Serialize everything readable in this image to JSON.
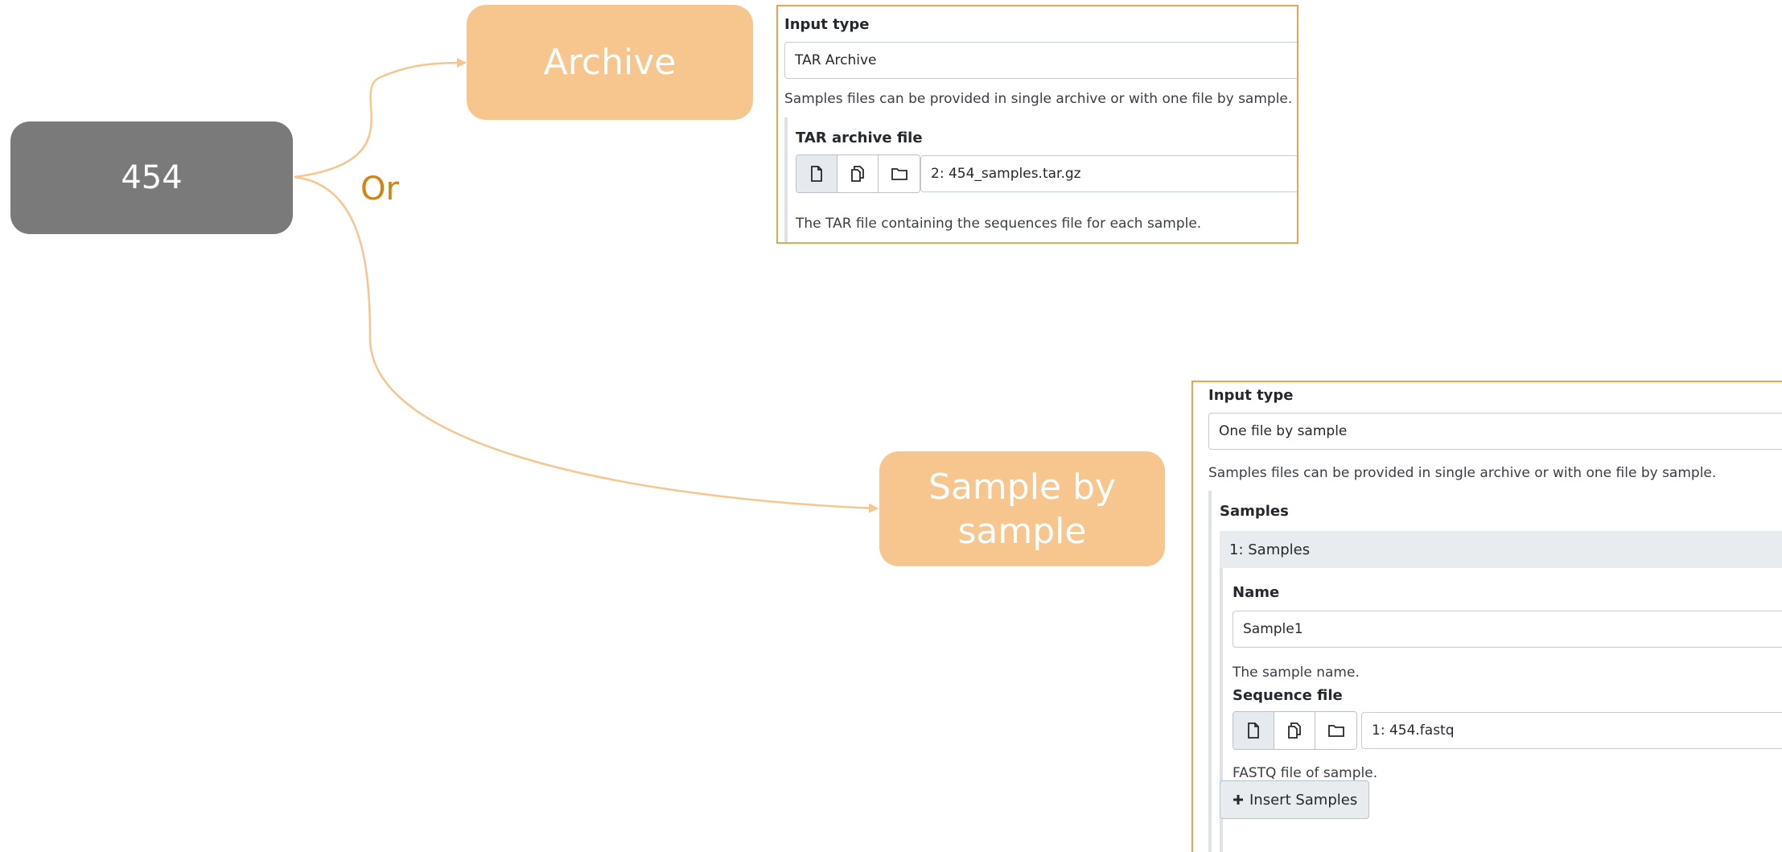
{
  "diagram": {
    "source_node": "454",
    "or_label": "Or",
    "archive_node": "Archive",
    "sample_node_line1": "Sample by",
    "sample_node_line2": "sample",
    "colors": {
      "source": "#7a7a7a",
      "option": "#f7c68f",
      "connector": "#f7c68f",
      "or_text": "#d4830f",
      "panel_border": "#f0a34c"
    }
  },
  "archive_panel": {
    "input_type_label": "Input type",
    "input_type_value": "TAR Archive",
    "input_type_help": "Samples files can be provided in single archive or with one file by sample.",
    "file_label": "TAR archive file",
    "file_value": "2: 454_samples.tar.gz",
    "file_help": "The TAR file containing the sequences file for each sample.",
    "icons": [
      "file-icon",
      "files-icon",
      "folder-icon"
    ]
  },
  "sample_panel": {
    "input_type_label": "Input type",
    "input_type_value": "One file by sample",
    "input_type_help": "Samples files can be provided in single archive or with one file by sample.",
    "samples_label": "Samples",
    "repeat_header": "1: Samples",
    "name_label": "Name",
    "name_value": "Sample1",
    "name_help": "The sample name.",
    "sequence_label": "Sequence file",
    "sequence_value": "1: 454.fastq",
    "sequence_help": "FASTQ file of sample.",
    "insert_button": "Insert Samples",
    "icons": [
      "file-icon",
      "files-icon",
      "folder-icon",
      "plus-icon"
    ]
  }
}
